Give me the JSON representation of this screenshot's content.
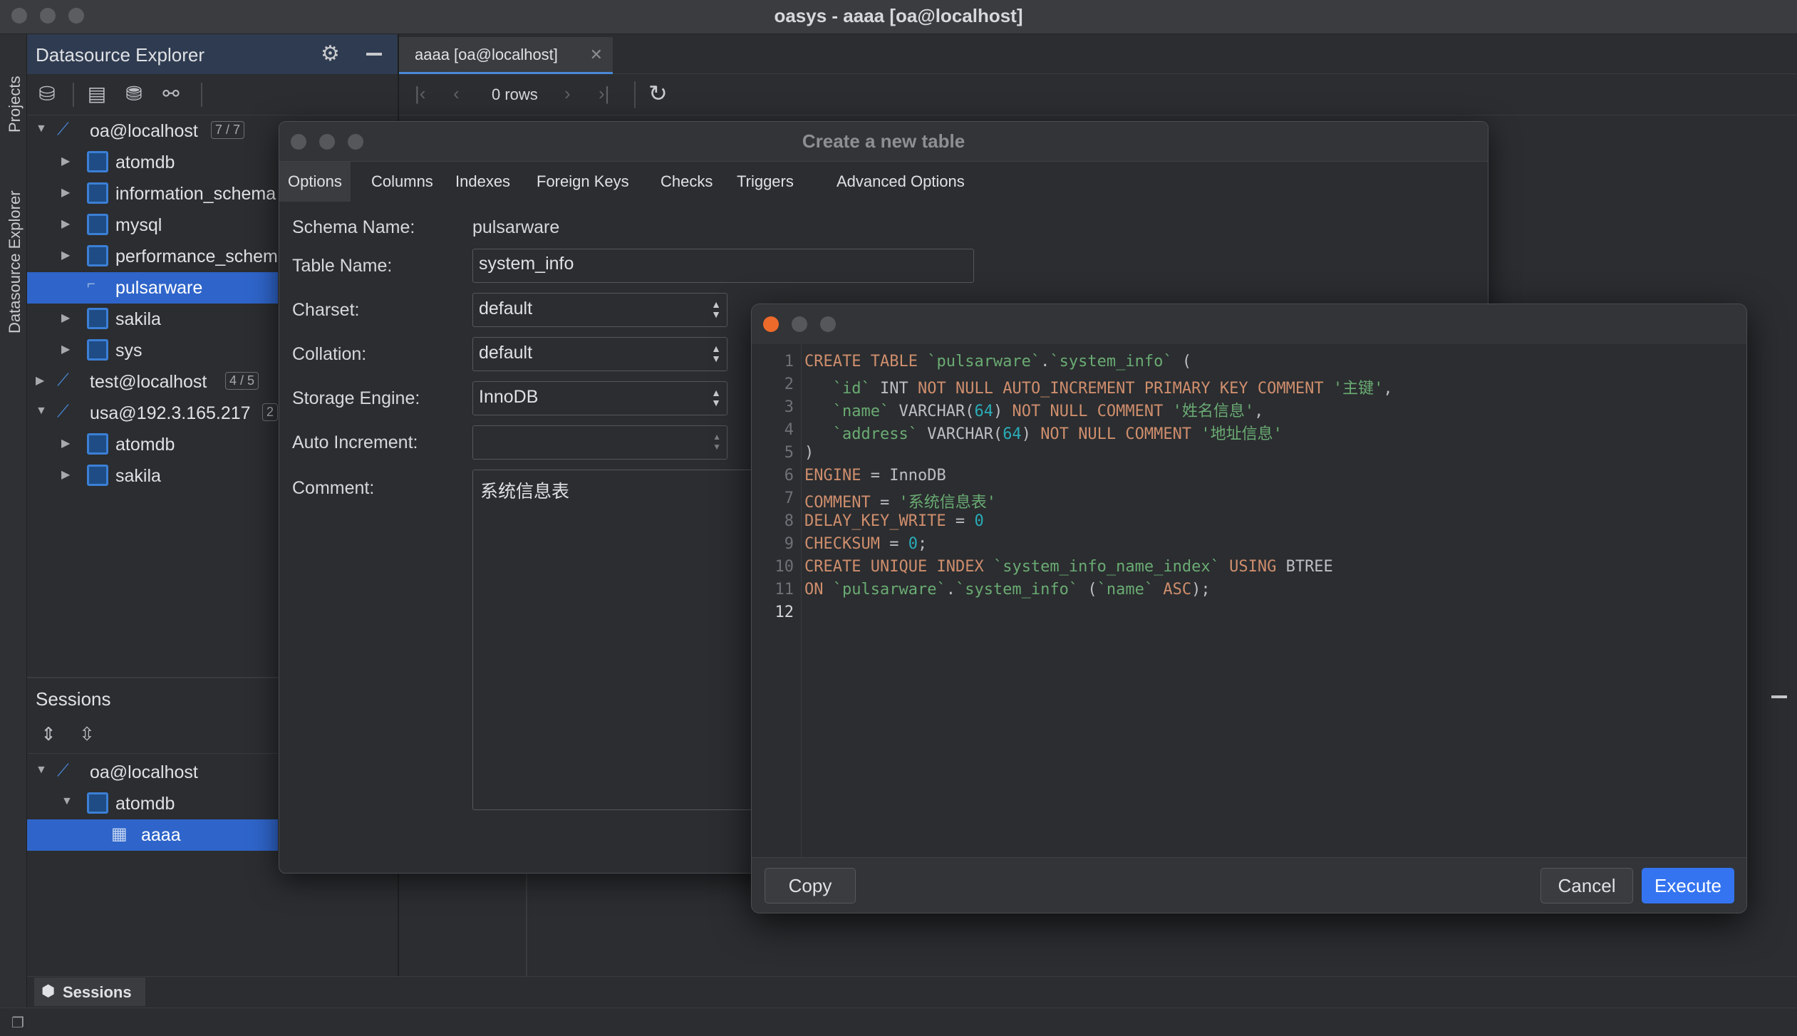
{
  "window": {
    "title": "oasys - aaaa [oa@localhost]"
  },
  "side_strip": {
    "projects": "Projects",
    "datasource_explorer": "Datasource Explorer"
  },
  "datasource_explorer": {
    "title": "Datasource Explorer",
    "tree": [
      {
        "label": "oa@localhost",
        "badge": "7 / 7",
        "type": "connection",
        "expanded": true
      },
      {
        "label": "atomdb",
        "type": "schema"
      },
      {
        "label": "information_schema",
        "type": "schema"
      },
      {
        "label": "mysql",
        "type": "schema"
      },
      {
        "label": "performance_schema",
        "type": "schema"
      },
      {
        "label": "pulsarware",
        "type": "schema",
        "selected": true
      },
      {
        "label": "sakila",
        "type": "schema"
      },
      {
        "label": "sys",
        "type": "schema"
      },
      {
        "label": "test@localhost",
        "badge": "4 / 5",
        "type": "connection"
      },
      {
        "label": "usa@192.3.165.217",
        "badge": "2",
        "type": "connection",
        "expanded": true
      },
      {
        "label": "atomdb",
        "type": "schema"
      },
      {
        "label": "sakila",
        "type": "schema"
      }
    ]
  },
  "sessions": {
    "title": "Sessions",
    "tree": [
      {
        "label": "oa@localhost"
      },
      {
        "label": "atomdb"
      },
      {
        "label": "aaaa",
        "selected": true
      }
    ],
    "bottom_tab": "Sessions"
  },
  "editor": {
    "tab_label": "aaaa [oa@localhost]",
    "rows_label": "0 rows"
  },
  "create_table_dialog": {
    "title": "Create a new table",
    "tabs": [
      "Options",
      "Columns",
      "Indexes",
      "Foreign Keys",
      "Checks",
      "Triggers",
      "Advanced Options"
    ],
    "active_tab": "Options",
    "fields": {
      "schema_name_label": "Schema Name:",
      "schema_name": "pulsarware",
      "table_name_label": "Table Name:",
      "table_name": "system_info",
      "charset_label": "Charset:",
      "charset": "default",
      "collation_label": "Collation:",
      "collation": "default",
      "engine_label": "Storage Engine:",
      "engine": "InnoDB",
      "auto_increment_label": "Auto Increment:",
      "auto_increment": "",
      "comment_label": "Comment:",
      "comment": "系统信息表"
    }
  },
  "sql_dialog": {
    "line_numbers": [
      "1",
      "2",
      "3",
      "4",
      "5",
      "6",
      "7",
      "8",
      "9",
      "10",
      "11",
      "12"
    ],
    "lines": [
      "CREATE TABLE `pulsarware`.`system_info` (",
      "   `id` INT NOT NULL AUTO_INCREMENT PRIMARY KEY COMMENT '主键',",
      "   `name` VARCHAR(64) NOT NULL COMMENT '姓名信息',",
      "   `address` VARCHAR(64) NOT NULL COMMENT '地址信息'",
      ")",
      "ENGINE = InnoDB",
      "COMMENT = '系统信息表'",
      "DELAY_KEY_WRITE = 0",
      "CHECKSUM = 0;",
      "CREATE UNIQUE INDEX `system_info_name_index` USING BTREE",
      "ON `pulsarware`.`system_info` (`name` ASC);",
      ""
    ],
    "buttons": {
      "copy": "Copy",
      "cancel": "Cancel",
      "execute": "Execute"
    }
  },
  "colors": {
    "accent": "#3574f0",
    "selection": "#2f65ca",
    "keyword": "#cf8e6d",
    "string": "#6aab73",
    "number": "#2aacb8"
  }
}
